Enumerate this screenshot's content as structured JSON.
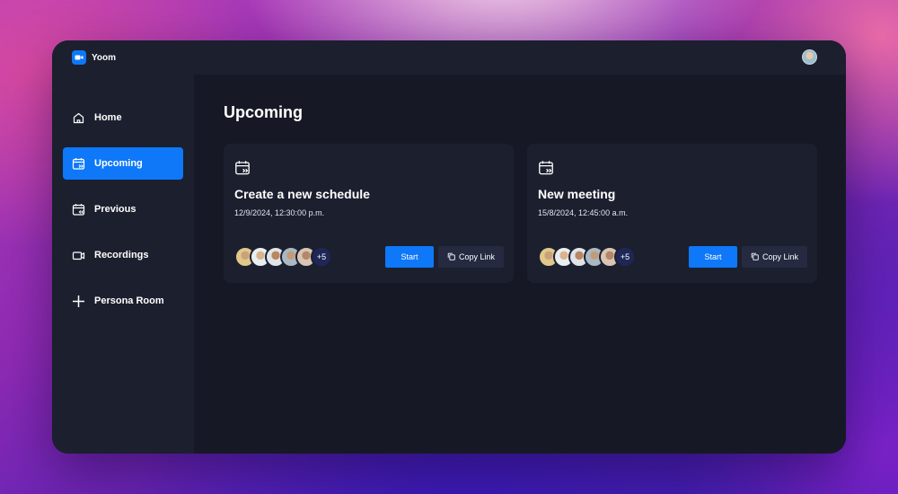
{
  "app": {
    "name": "Yoom"
  },
  "sidebar": {
    "items": [
      {
        "label": "Home",
        "icon": "home-icon"
      },
      {
        "label": "Upcoming",
        "icon": "calendar-upcoming-icon",
        "active": true
      },
      {
        "label": "Previous",
        "icon": "calendar-previous-icon"
      },
      {
        "label": "Recordings",
        "icon": "video-icon"
      },
      {
        "label": "Persona Room",
        "icon": "plus-icon"
      }
    ]
  },
  "main": {
    "title": "Upcoming",
    "cards": [
      {
        "title": "Create a new schedule",
        "date": "12/9/2024, 12:30:00 p.m.",
        "more_count": "+5",
        "start_label": "Start",
        "copy_label": "Copy Link"
      },
      {
        "title": "New meeting",
        "date": "15/8/2024, 12:45:00 a.m.",
        "more_count": "+5",
        "start_label": "Start",
        "copy_label": "Copy Link"
      }
    ]
  },
  "colors": {
    "accent": "#0e78f9",
    "window_bg": "#161925",
    "panel_bg": "#1c1f2e",
    "secondary_button": "#252a41"
  }
}
